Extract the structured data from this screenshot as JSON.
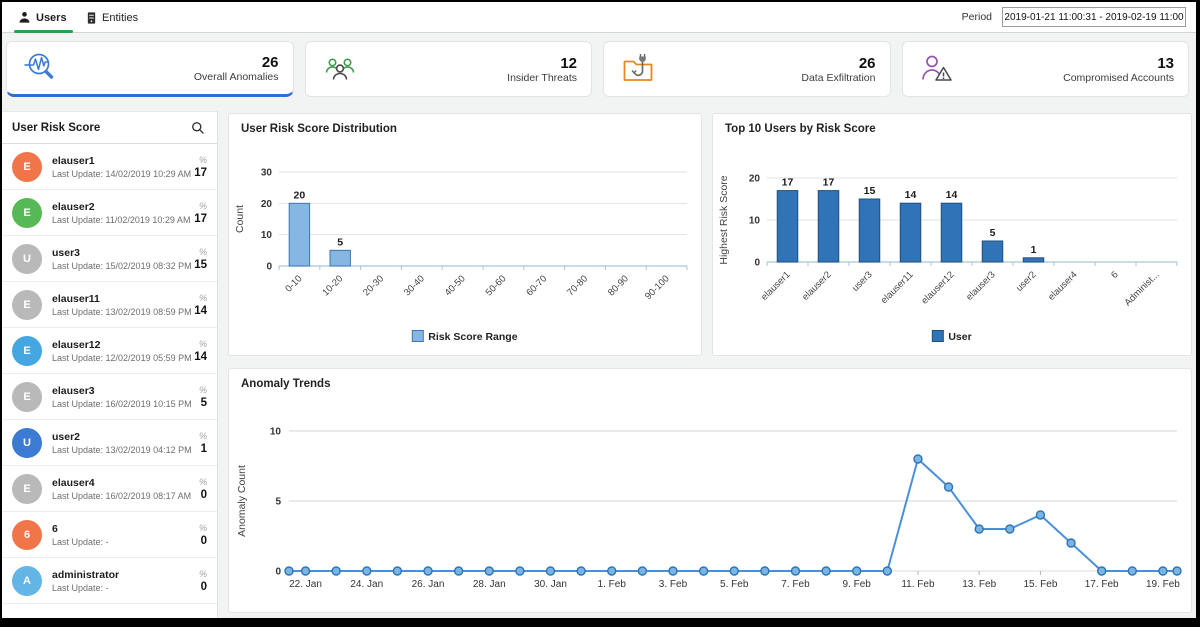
{
  "topbar": {
    "tabs": [
      {
        "label": "Users"
      },
      {
        "label": "Entities"
      }
    ],
    "active_tab": "Users",
    "active_tab_underline_color": "#2aa14a",
    "period_label": "Period",
    "period_value": "2019-01-21 11:00:31 - 2019-02-19 11:00"
  },
  "kpis": [
    {
      "value": "26",
      "label": "Overall Anomalies",
      "icon": "anomaly-search-icon",
      "accent": "#3a7bd5",
      "active": true
    },
    {
      "value": "12",
      "label": "Insider Threats",
      "icon": "insider-threats-icon",
      "accent": "#3f9e4d",
      "active": false
    },
    {
      "value": "26",
      "label": "Data Exfiltration",
      "icon": "data-exfiltration-icon",
      "accent": "#e8871e",
      "active": false
    },
    {
      "value": "13",
      "label": "Compromised Accounts",
      "icon": "compromised-accounts-icon",
      "accent": "#9455b0",
      "active": false
    }
  ],
  "sidebar": {
    "title": "User Risk Score",
    "users": [
      {
        "initial": "E",
        "name": "elauser1",
        "last_update": "Last Update: 14/02/2019 10:29 AM",
        "score": "17",
        "avatar_color": "#f0764a"
      },
      {
        "initial": "E",
        "name": "elauser2",
        "last_update": "Last Update: 11/02/2019 10:29 AM",
        "score": "17",
        "avatar_color": "#57b955"
      },
      {
        "initial": "U",
        "name": "user3",
        "last_update": "Last Update: 15/02/2019 08:32 PM",
        "score": "15",
        "avatar_color": "#b9b9b9"
      },
      {
        "initial": "E",
        "name": "elauser11",
        "last_update": "Last Update: 13/02/2019 08:59 PM",
        "score": "14",
        "avatar_color": "#b9b9b9"
      },
      {
        "initial": "E",
        "name": "elauser12",
        "last_update": "Last Update: 12/02/2019 05:59 PM",
        "score": "14",
        "avatar_color": "#45a7e2"
      },
      {
        "initial": "E",
        "name": "elauser3",
        "last_update": "Last Update: 16/02/2019 10:15 PM",
        "score": "5",
        "avatar_color": "#b9b9b9"
      },
      {
        "initial": "U",
        "name": "user2",
        "last_update": "Last Update: 13/02/2019 04:12 PM",
        "score": "1",
        "avatar_color": "#3b7bd4"
      },
      {
        "initial": "E",
        "name": "elauser4",
        "last_update": "Last Update: 16/02/2019 08:17 AM",
        "score": "0",
        "avatar_color": "#b9b9b9"
      },
      {
        "initial": "6",
        "name": "6",
        "last_update": "Last Update: -",
        "score": "0",
        "avatar_color": "#f0764a"
      },
      {
        "initial": "A",
        "name": "administrator",
        "last_update": "Last Update: -",
        "score": "0",
        "avatar_color": "#62b5e5"
      }
    ]
  },
  "chart_data": [
    {
      "type": "bar",
      "title": "User Risk Score Distribution",
      "categories": [
        "0-10",
        "10-20",
        "20-30",
        "30-40",
        "40-50",
        "50-60",
        "60-70",
        "70-80",
        "80-90",
        "90-100"
      ],
      "values": [
        20,
        5,
        0,
        0,
        0,
        0,
        0,
        0,
        0,
        0
      ],
      "xlabel": "",
      "ylabel": "Count",
      "yticks": [
        0,
        10,
        20,
        30
      ],
      "ylim": [
        0,
        30
      ],
      "grid": true,
      "legend": "Risk Score Range",
      "legend_position": "bottom",
      "bar_fill": "#85b7e2",
      "bar_stroke": "#3c76ad"
    },
    {
      "type": "bar",
      "title": "Top 10 Users by Risk Score",
      "categories": [
        "elauser1",
        "elauser2",
        "user3",
        "elauser11",
        "elauser12",
        "elauser3",
        "user2",
        "elauser4",
        "6",
        "Administ..."
      ],
      "values": [
        17,
        17,
        15,
        14,
        14,
        5,
        1,
        0,
        0,
        0
      ],
      "xlabel": "",
      "ylabel": "Highest Risk Score",
      "yticks": [
        0,
        10,
        20
      ],
      "ylim": [
        0,
        20
      ],
      "grid": true,
      "legend": "User",
      "legend_position": "bottom",
      "bar_fill": "#3074b7",
      "bar_stroke": "#1e4f7e"
    },
    {
      "type": "line",
      "title": "Anomaly Trends",
      "ylabel": "Anomaly Count",
      "yticks": [
        0,
        5,
        10
      ],
      "ylim": [
        0,
        10
      ],
      "xlim": [
        0,
        29
      ],
      "grid": true,
      "line_color": "#4a90d9",
      "marker_fill": "#7ab4e2",
      "marker_stroke": "#2e74b5",
      "x_ticks": [
        {
          "x": 0.54,
          "label": "22. Jan"
        },
        {
          "x": 2.54,
          "label": "24. Jan"
        },
        {
          "x": 4.54,
          "label": "26. Jan"
        },
        {
          "x": 6.54,
          "label": "28. Jan"
        },
        {
          "x": 8.54,
          "label": "30. Jan"
        },
        {
          "x": 10.54,
          "label": "1. Feb"
        },
        {
          "x": 12.54,
          "label": "3. Feb"
        },
        {
          "x": 14.54,
          "label": "5. Feb"
        },
        {
          "x": 16.54,
          "label": "7. Feb"
        },
        {
          "x": 18.54,
          "label": "9. Feb"
        },
        {
          "x": 20.54,
          "label": "11. Feb"
        },
        {
          "x": 22.54,
          "label": "13. Feb"
        },
        {
          "x": 24.54,
          "label": "15. Feb"
        },
        {
          "x": 26.54,
          "label": "17. Feb"
        },
        {
          "x": 28.54,
          "label": "19. Feb"
        }
      ],
      "points": [
        [
          0,
          0
        ],
        [
          0.54,
          0
        ],
        [
          1.54,
          0
        ],
        [
          2.54,
          0
        ],
        [
          3.54,
          0
        ],
        [
          4.54,
          0
        ],
        [
          5.54,
          0
        ],
        [
          6.54,
          0
        ],
        [
          7.54,
          0
        ],
        [
          8.54,
          0
        ],
        [
          9.54,
          0
        ],
        [
          10.54,
          0
        ],
        [
          11.54,
          0
        ],
        [
          12.54,
          0
        ],
        [
          13.54,
          0
        ],
        [
          14.54,
          0
        ],
        [
          15.54,
          0
        ],
        [
          16.54,
          0
        ],
        [
          17.54,
          0
        ],
        [
          18.54,
          0
        ],
        [
          19.54,
          0
        ],
        [
          20.54,
          8
        ],
        [
          21.54,
          6
        ],
        [
          22.54,
          3
        ],
        [
          23.54,
          3
        ],
        [
          24.54,
          4
        ],
        [
          25.54,
          2
        ],
        [
          26.54,
          0
        ],
        [
          27.54,
          0
        ],
        [
          28.54,
          0
        ],
        [
          29,
          0
        ]
      ]
    }
  ]
}
